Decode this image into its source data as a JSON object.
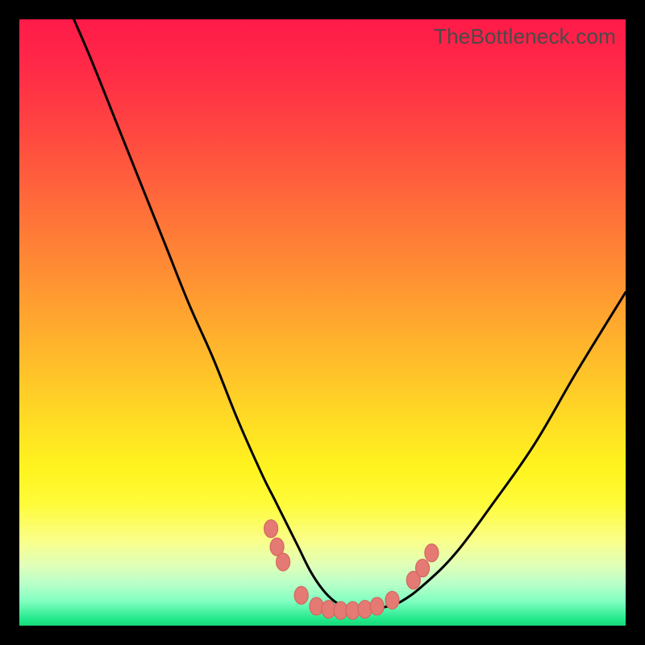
{
  "watermark": "TheBottleneck.com",
  "chart_data": {
    "type": "line",
    "title": "",
    "xlabel": "",
    "ylabel": "",
    "xlim": [
      0,
      100
    ],
    "ylim": [
      0,
      100
    ],
    "grid": false,
    "legend": false,
    "series": [
      {
        "name": "curve",
        "x": [
          9,
          12,
          16,
          20,
          24,
          28,
          32,
          36,
          40,
          42,
          44,
          46,
          48,
          50,
          52,
          54,
          56,
          58,
          60,
          63,
          67,
          72,
          78,
          85,
          92,
          100
        ],
        "y": [
          100,
          93,
          83,
          73,
          63,
          53,
          44,
          34,
          25,
          21,
          17,
          13,
          9,
          6,
          4,
          3,
          2.5,
          2.5,
          3,
          4,
          7,
          12,
          20,
          30,
          42,
          55
        ]
      }
    ],
    "markers": [
      {
        "x": 41.5,
        "y": 16
      },
      {
        "x": 42.5,
        "y": 13
      },
      {
        "x": 43.5,
        "y": 10.5
      },
      {
        "x": 46.5,
        "y": 5
      },
      {
        "x": 49.0,
        "y": 3.2
      },
      {
        "x": 51.0,
        "y": 2.7
      },
      {
        "x": 53.0,
        "y": 2.5
      },
      {
        "x": 55.0,
        "y": 2.5
      },
      {
        "x": 57.0,
        "y": 2.7
      },
      {
        "x": 59.0,
        "y": 3.2
      },
      {
        "x": 61.5,
        "y": 4.2
      },
      {
        "x": 65.0,
        "y": 7.5
      },
      {
        "x": 66.5,
        "y": 9.5
      },
      {
        "x": 68.0,
        "y": 12.0
      }
    ],
    "colors": {
      "curve": "#000000",
      "markers": "#e47a73",
      "gradient_top": "#ff1a49",
      "gradient_mid": "#ffd825",
      "gradient_bottom": "#18d878"
    }
  }
}
